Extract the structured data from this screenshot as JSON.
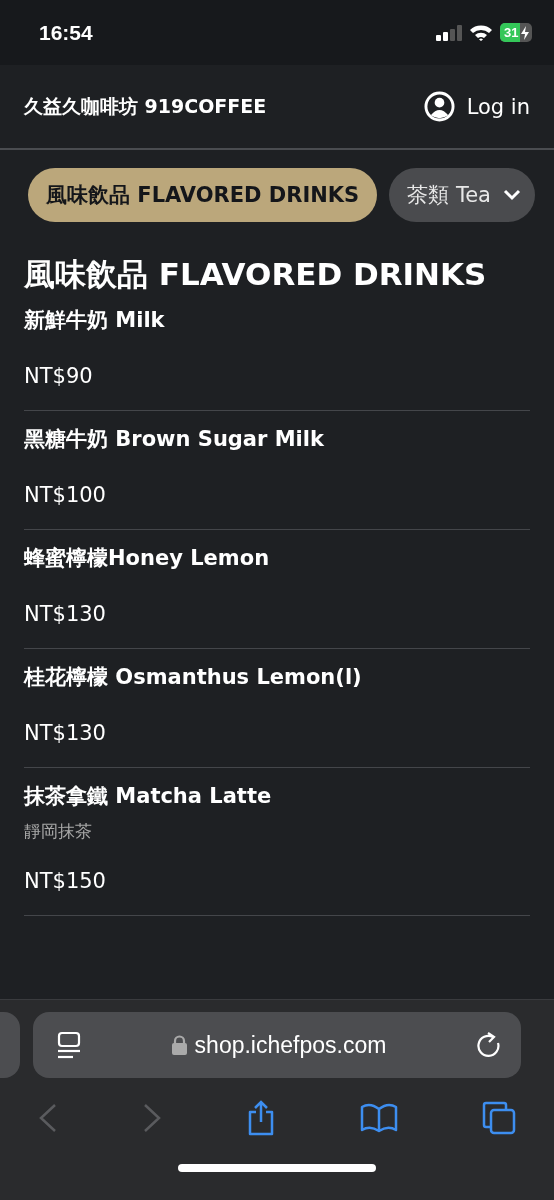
{
  "status_bar": {
    "time": "16:54",
    "battery": "31"
  },
  "header": {
    "store_name": "久益久咖啡坊 919COFFEE",
    "login": "Log in"
  },
  "tabs": [
    {
      "label": "風味飲品 FLAVORED DRINKS",
      "selected": true
    },
    {
      "label": "茶類 Tea",
      "selected": false
    }
  ],
  "section": {
    "title": "風味飲品 FLAVORED DRINKS"
  },
  "items": [
    {
      "name": "新鮮牛奶 Milk",
      "price": "NT$90"
    },
    {
      "name": "黑糖牛奶 Brown Sugar Milk",
      "price": "NT$100"
    },
    {
      "name": "蜂蜜檸檬Honey Lemon",
      "price": "NT$130"
    },
    {
      "name": "桂花檸檬 Osmanthus Lemon(l)",
      "price": "NT$130"
    },
    {
      "name": "抹茶拿鐵 Matcha Latte",
      "description": "靜岡抹茶",
      "price": "NT$150"
    }
  ],
  "browser": {
    "url": "shop.ichefpos.com",
    "back_disabled": true,
    "forward_disabled": true
  }
}
